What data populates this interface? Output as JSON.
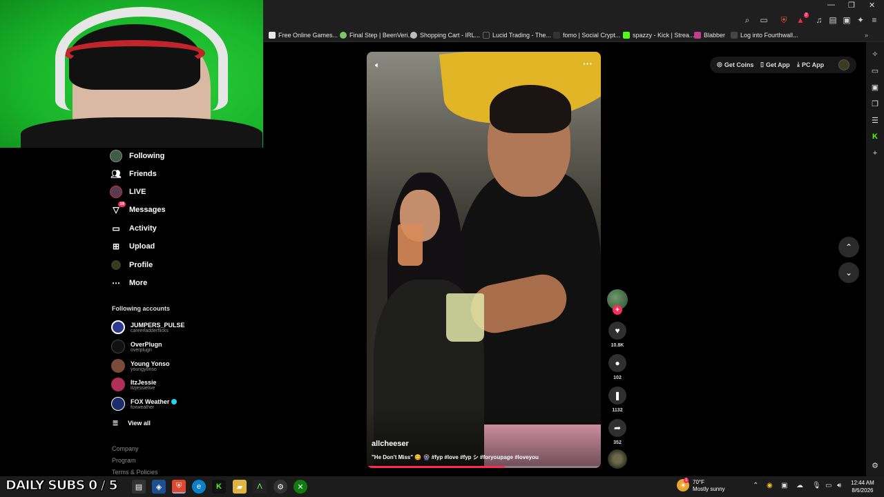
{
  "window": {
    "minimize": "—",
    "restore": "❐",
    "close": "✕"
  },
  "toolbar": {
    "icons": [
      "search-icon",
      "cast-icon",
      "shield-icon",
      "alert-icon",
      "music-icon",
      "sidebar-icon",
      "wallet-icon",
      "extension-icon",
      "leo-icon",
      "menu-icon"
    ],
    "notification_count": "2"
  },
  "bookmarks": [
    {
      "label": "Free Online Games...",
      "color": "#e8e8e8"
    },
    {
      "label": "Final Step | BeenVeri...",
      "color": "#7bc46b"
    },
    {
      "label": "Shopping Cart - IRL...",
      "color": "#bbbbbb"
    },
    {
      "label": "Lucid Trading - The...",
      "color": "#222222"
    },
    {
      "label": "fomo | Social Crypt...",
      "color": "#333333"
    },
    {
      "label": "spazzy - Kick | Strea...",
      "color": "#53fc18"
    },
    {
      "label": "Blabber",
      "color": "#c23d8e"
    },
    {
      "label": "Log into Fourthwall...",
      "color": "#444444"
    }
  ],
  "nav": {
    "items": [
      {
        "label": "Following",
        "icon": "following-avatar-icon"
      },
      {
        "label": "Friends",
        "icon": "friends-icon"
      },
      {
        "label": "LIVE",
        "icon": "live-icon"
      },
      {
        "label": "Messages",
        "icon": "messages-icon",
        "badge": "19"
      },
      {
        "label": "Activity",
        "icon": "activity-icon"
      },
      {
        "label": "Upload",
        "icon": "upload-icon"
      },
      {
        "label": "Profile",
        "icon": "profile-icon"
      },
      {
        "label": "More",
        "icon": "more-icon"
      }
    ],
    "following_title": "Following accounts",
    "accounts": [
      {
        "name": "JUMPERS_PULSE",
        "user": "careerladderflicks",
        "color": "#2a3b8f",
        "verified": false
      },
      {
        "name": "OverPlugn",
        "user": "overplugn",
        "color": "#111111",
        "verified": false
      },
      {
        "name": "Young Yonso",
        "user": "youngyonso",
        "color": "#7a4a3a",
        "verified": false
      },
      {
        "name": "ItzJessie",
        "user": "itzjessielive",
        "color": "#b0305a",
        "verified": false
      },
      {
        "name": "FOX Weather",
        "user": "foxweather",
        "color": "#1b2d6b",
        "verified": true
      }
    ],
    "view_all": "View all",
    "footer": [
      "Company",
      "Program",
      "Terms & Policies"
    ]
  },
  "video": {
    "author": "allcheeser",
    "caption": "\"He Don't Miss\" 😋 🎡 #fyp #love #fyp シ #foryoupage #loveyou",
    "progress": 0.59
  },
  "actions": {
    "likes": "10.8K",
    "comments": "102",
    "saves": "1132",
    "shares": "352"
  },
  "top_buttons": {
    "coins": "Get Coins",
    "app": "Get App",
    "pc_app": "PC App"
  },
  "taskbar": {
    "subs_text": "DAILY SUBS 0 / 5",
    "weather_temp": "70°F",
    "weather_desc": "Mostly sunny",
    "weather_badge": "1",
    "time": "12:44 AM",
    "date": "8/6/2026"
  }
}
